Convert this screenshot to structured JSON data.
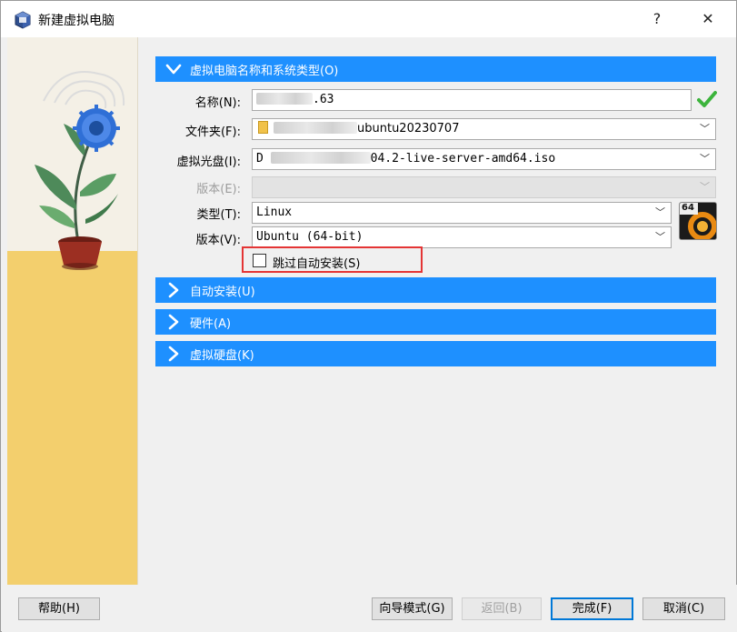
{
  "window": {
    "title": "新建虚拟电脑",
    "help_glyph": "?",
    "close_glyph": "✕"
  },
  "sections": {
    "name_os": {
      "label": "虚拟电脑名称和系统类型(O)",
      "expanded": true
    },
    "unattended": {
      "label": "自动安装(U)",
      "expanded": false
    },
    "hardware": {
      "label": "硬件(A)",
      "expanded": false
    },
    "hard_disk": {
      "label": "虚拟硬盘(K)",
      "expanded": false
    }
  },
  "form": {
    "name_label": "名称(N):",
    "name_value_visible": ".63",
    "folder_label": "文件夹(F):",
    "folder_value_visible": "ubuntu20230707",
    "iso_label": "虚拟光盘(I):",
    "iso_value_prefix": "D",
    "iso_value_visible": "04.2-live-server-amd64.iso",
    "edition_label": "版本(E):",
    "type_label": "类型(T):",
    "type_value": "Linux",
    "version_label": "版本(V):",
    "version_value": "Ubuntu (64-bit)",
    "os_badge_text": "64",
    "skip_unattended_label": "跳过自动安装(S)",
    "skip_unattended_checked": false
  },
  "buttons": {
    "help": "帮助(H)",
    "guided_mode": "向导模式(G)",
    "back": "返回(B)",
    "finish": "完成(F)",
    "cancel": "取消(C)"
  },
  "colors": {
    "section_bg": "#1e90ff",
    "highlight_border": "#e43535",
    "ok_green": "#3cb43c"
  }
}
